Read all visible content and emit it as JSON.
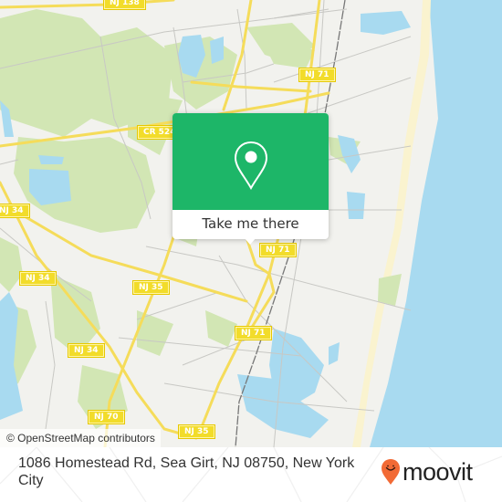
{
  "map": {
    "attribution": "© OpenStreetMap contributors",
    "colors": {
      "land": "#f2f2ee",
      "water": "#a8daf0",
      "park": "#d2e6b4",
      "road_major": "#f5dc5a",
      "road_minor": "#c8c8c4",
      "beach": "#faf3cf",
      "popup_green": "#1db668"
    },
    "route_shields": [
      {
        "label": "NJ 138"
      },
      {
        "label": "CR 524"
      },
      {
        "label": "NJ 71"
      },
      {
        "label": "NJ 34"
      },
      {
        "label": "NJ 34"
      },
      {
        "label": "NJ 35"
      },
      {
        "label": "NJ 71"
      },
      {
        "label": "NJ 34"
      },
      {
        "label": "NJ 71"
      },
      {
        "label": "NJ 70"
      },
      {
        "label": "NJ 35"
      }
    ]
  },
  "popup": {
    "icon": "map-pin-icon",
    "button_label": "Take me there"
  },
  "footer": {
    "address": "1086 Homestead Rd, Sea Girt, NJ 08750, New York City",
    "brand": "moovit",
    "brand_icon": "moovit-smiley-pin-icon",
    "brand_color": "#f26a35"
  }
}
